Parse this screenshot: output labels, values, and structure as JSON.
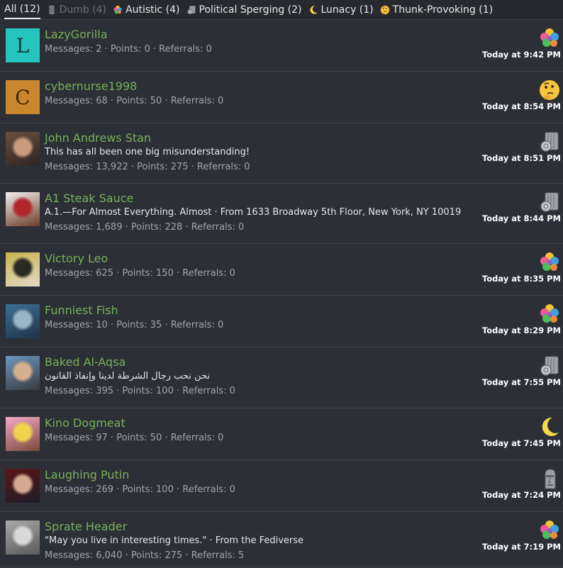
{
  "tabs": [
    {
      "label": "All (12)",
      "active": true,
      "icon": "",
      "dim": false
    },
    {
      "label": "Dumb (4)",
      "active": false,
      "icon": "ruler-icon",
      "dim": true
    },
    {
      "label": "Autistic (4)",
      "active": false,
      "icon": "puzzle-icon",
      "dim": false
    },
    {
      "label": "Political Sperging (2)",
      "active": false,
      "icon": "scroll-icon",
      "dim": false
    },
    {
      "label": "Lunacy (1)",
      "active": false,
      "icon": "moon-icon",
      "dim": false
    },
    {
      "label": "Thunk-Provoking (1)",
      "active": false,
      "icon": "thinking-icon",
      "dim": false
    }
  ],
  "members": [
    {
      "name": "LazyGorilla",
      "blurb": "",
      "stats": "Messages: 2 · Points: 0 · Referrals: 0",
      "time": "Today at 9:42 PM",
      "reaction": "puzzle-icon",
      "avatar": {
        "type": "letter",
        "letter": "L",
        "bg": "#26c4bf",
        "fg": "#0b3b3a"
      }
    },
    {
      "name": "cybernurse1998",
      "blurb": "",
      "stats": "Messages: 68 · Points: 50 · Referrals: 0",
      "time": "Today at 8:54 PM",
      "reaction": "thinking-icon",
      "avatar": {
        "type": "letter",
        "letter": "C",
        "bg": "#c9862c",
        "fg": "#3e2706"
      }
    },
    {
      "name": "John Andrews Stan",
      "blurb": "This has all been one big misunderstanding!",
      "stats": "Messages: 13,922 · Points: 275 · Referrals: 0",
      "time": "Today at 8:51 PM",
      "reaction": "scroll-icon",
      "avatar": {
        "type": "photo",
        "colors": [
          "#6a5040",
          "#c99a7c",
          "#2b2424"
        ]
      }
    },
    {
      "name": "A1 Steak Sauce",
      "blurb": "A.1.—For Almost Everything. Almost · From 1633 Broadway 5th Floor, New York, NY 10019",
      "stats": "Messages: 1,689 · Points: 228 · Referrals: 0",
      "time": "Today at 8:44 PM",
      "reaction": "scroll-icon",
      "avatar": {
        "type": "photo",
        "colors": [
          "#f4f0ee",
          "#b0262b",
          "#6b3b2a"
        ]
      }
    },
    {
      "name": "Victory Leo",
      "blurb": "",
      "stats": "Messages: 625 · Points: 150 · Referrals: 0",
      "time": "Today at 8:35 PM",
      "reaction": "puzzle-icon",
      "avatar": {
        "type": "photo",
        "colors": [
          "#c9b34a",
          "#2a2a24",
          "#e0dac8"
        ]
      }
    },
    {
      "name": "Funniest Fish",
      "blurb": "",
      "stats": "Messages: 10 · Points: 35 · Referrals: 0",
      "time": "Today at 8:29 PM",
      "reaction": "puzzle-icon",
      "avatar": {
        "type": "photo",
        "colors": [
          "#3d6f98",
          "#9ab4c8",
          "#1f3346"
        ]
      }
    },
    {
      "name": "Baked Al-Aqsa",
      "blurb": "نحن نحب رجال الشرطة لدينا وإنفاذ القانون",
      "stats": "Messages: 395 · Points: 100 · Referrals: 0",
      "time": "Today at 7:55 PM",
      "reaction": "scroll-icon",
      "avatar": {
        "type": "photo",
        "colors": [
          "#6a98c4",
          "#d5b08c",
          "#3a3a3a"
        ]
      }
    },
    {
      "name": "Kino Dogmeat",
      "blurb": "",
      "stats": "Messages: 97 · Points: 50 · Referrals: 0",
      "time": "Today at 7:45 PM",
      "reaction": "moon-icon",
      "avatar": {
        "type": "photo",
        "colors": [
          "#f3a9c9",
          "#f1d34b",
          "#7a4a3a"
        ]
      }
    },
    {
      "name": "Laughing Putin",
      "blurb": "",
      "stats": "Messages: 269 · Points: 100 · Referrals: 0",
      "time": "Today at 7:24 PM",
      "reaction": "moai-icon",
      "avatar": {
        "type": "photo",
        "colors": [
          "#5b1616",
          "#d4a891",
          "#1c1c28"
        ]
      }
    },
    {
      "name": "Sprate Header",
      "blurb": "\"May you live in interesting times.\" · From the Fediverse",
      "stats": "Messages: 6,040 · Points: 275 · Referrals: 5",
      "time": "Today at 7:19 PM",
      "reaction": "puzzle-icon",
      "avatar": {
        "type": "photo",
        "colors": [
          "#a9a9a9",
          "#d9d9d9",
          "#5a5a5a"
        ]
      }
    }
  ],
  "colors": {
    "background": "#2c2f36",
    "username": "#77b05b",
    "separator": "#3e4148"
  }
}
